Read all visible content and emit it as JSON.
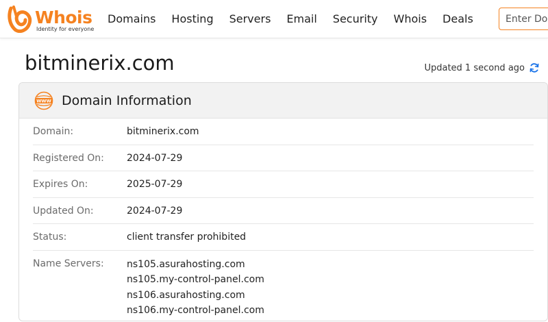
{
  "header": {
    "logo_text": "Whois",
    "logo_tagline": "Identity for everyone",
    "nav": [
      "Domains",
      "Hosting",
      "Servers",
      "Email",
      "Security",
      "Whois",
      "Deals"
    ],
    "search_placeholder": "Enter Domain or IP"
  },
  "page": {
    "domain": "bitminerix.com",
    "updated_text": "Updated 1 second ago"
  },
  "card": {
    "title": "Domain Information",
    "rows": [
      {
        "label": "Domain:",
        "value": "bitminerix.com"
      },
      {
        "label": "Registered On:",
        "value": "2024-07-29"
      },
      {
        "label": "Expires On:",
        "value": "2025-07-29"
      },
      {
        "label": "Updated On:",
        "value": "2024-07-29"
      },
      {
        "label": "Status:",
        "value": "client transfer prohibited"
      },
      {
        "label": "Name Servers:",
        "values": [
          "ns105.asurahosting.com",
          "ns105.my-control-panel.com",
          "ns106.asurahosting.com",
          "ns106.my-control-panel.com"
        ]
      }
    ]
  },
  "colors": {
    "brand_orange": "#f58220",
    "refresh_blue": "#1a73e8"
  },
  "icons": {
    "logo": "whois-logo-icon",
    "refresh": "refresh-icon",
    "card": "www-globe-icon"
  }
}
